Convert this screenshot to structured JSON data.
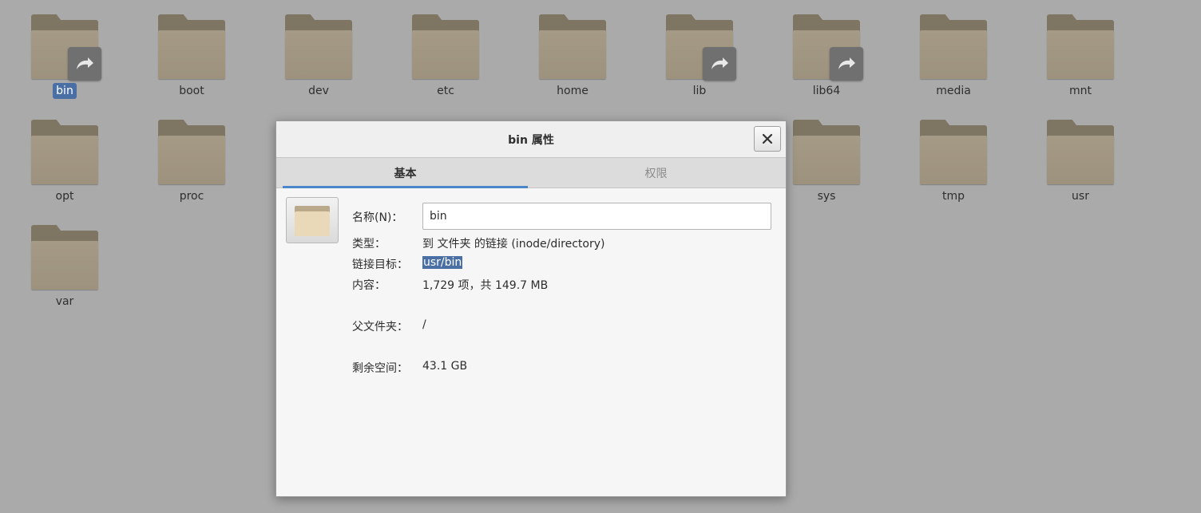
{
  "desktop": {
    "items": [
      {
        "label": "bin",
        "symlink": true,
        "selected": true
      },
      {
        "label": "boot"
      },
      {
        "label": "dev"
      },
      {
        "label": "etc"
      },
      {
        "label": "home"
      },
      {
        "label": "lib",
        "symlink": true
      },
      {
        "label": "lib64",
        "symlink": true
      },
      {
        "label": "media"
      },
      {
        "label": "mnt"
      },
      {
        "label": "opt"
      },
      {
        "label": "proc"
      },
      {
        "label": "sys"
      },
      {
        "label": "tmp"
      },
      {
        "label": "usr"
      },
      {
        "label": "var"
      }
    ]
  },
  "dialog": {
    "title": "bin 属性",
    "close_icon": "close-icon",
    "tabs": [
      {
        "label": "基本",
        "active": true
      },
      {
        "label": "权限",
        "active": false
      }
    ],
    "fields": {
      "name_label": "名称(N)：",
      "name_value": "bin",
      "type_label": "类型：",
      "type_value": "到 文件夹 的链接 (inode/directory)",
      "link_target_label": "链接目标：",
      "link_target_value": "usr/bin",
      "contents_label": "内容：",
      "contents_value": "1,729 项，共 149.7 MB",
      "parent_label": "父文件夹：",
      "parent_value": "/",
      "free_space_label": "剩余空间：",
      "free_space_value": "43.1 GB"
    }
  },
  "colors": {
    "desktop_bg": "#aaaaaa",
    "selection": "#4a6fa5",
    "folder": "#9d927d"
  }
}
